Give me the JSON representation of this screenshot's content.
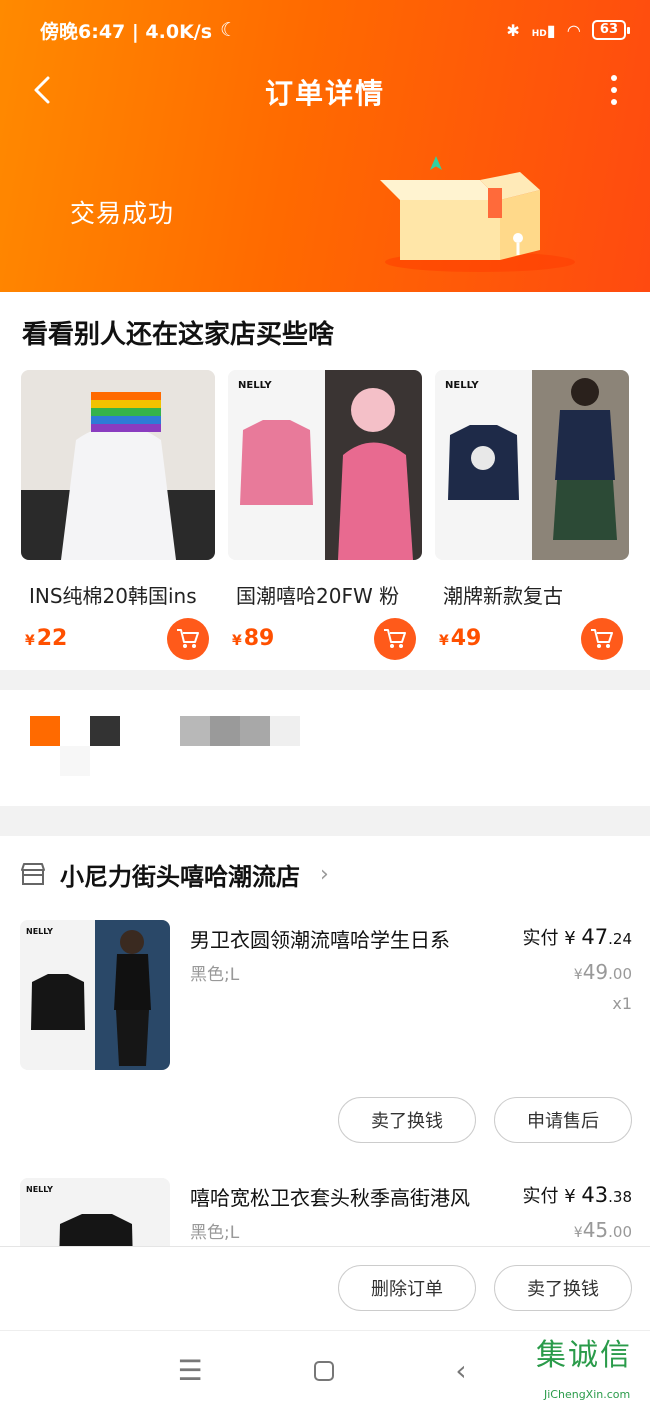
{
  "status_bar": {
    "time": "傍晚6:47 | 4.0K/s",
    "signal": "HD",
    "battery": "63"
  },
  "nav": {
    "title": "订单详情"
  },
  "order_status": {
    "text": "交易成功"
  },
  "recommendations": {
    "title": "看看别人还在这家店买些啥",
    "currency": "¥",
    "items": [
      {
        "name": "INS纯棉20韩国ins",
        "price": "22"
      },
      {
        "name": "国潮嘻哈20FW 粉",
        "price": "89"
      },
      {
        "name": "潮牌新款复古",
        "price": "49"
      }
    ],
    "brand_label": "NELLY"
  },
  "shop": {
    "name": "小尼力街头嘻哈潮流店"
  },
  "order_items": [
    {
      "title": "男卫衣圆领潮流嘻哈学生日系",
      "sku": "黑色;L",
      "paid_label": "实付",
      "currency": "¥",
      "paid_int": "47",
      "paid_dec": ".24",
      "orig_int": "49",
      "orig_dec": ".00",
      "qty": "x1"
    },
    {
      "title": "嘻哈宽松卫衣套头秋季高街港风",
      "sku": "黑色;L",
      "paid_label": "实付",
      "currency": "¥",
      "paid_int": "43",
      "paid_dec": ".38",
      "orig_int": "45",
      "orig_dec": ".00"
    }
  ],
  "item_actions": {
    "sell": "卖了换钱",
    "after_sale": "申请售后"
  },
  "bottom_actions": {
    "delete": "删除订单",
    "sell": "卖了换钱"
  },
  "watermark": {
    "zh": "集诚信",
    "en": "JiChengXin.com"
  },
  "colors": {
    "accent": "#ff5000",
    "header_start": "#ff8a00",
    "header_end": "#ff4a10"
  }
}
